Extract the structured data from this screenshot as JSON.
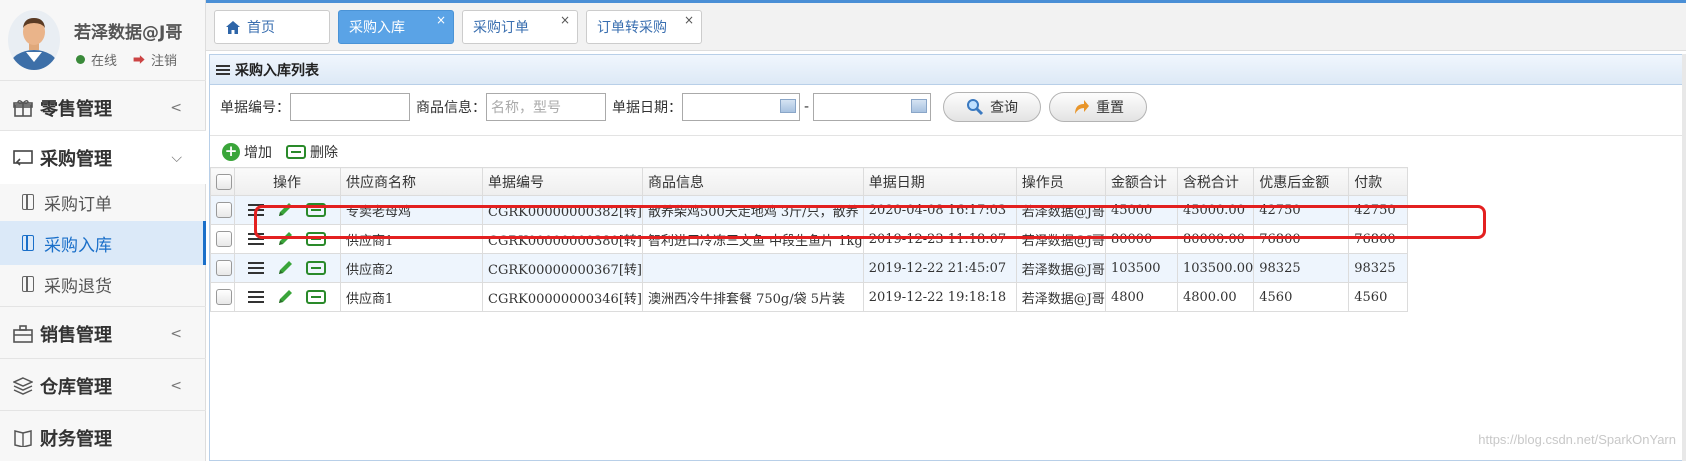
{
  "user": {
    "name": "若泽数据@J哥",
    "status": "在线",
    "logout": "注销"
  },
  "sidebar": {
    "menus": [
      {
        "label": "零售管理",
        "icon": "gift-icon",
        "open": false
      },
      {
        "label": "采购管理",
        "icon": "purchase-icon",
        "open": true
      },
      {
        "label": "销售管理",
        "icon": "briefcase-icon",
        "open": false
      },
      {
        "label": "仓库管理",
        "icon": "layers-icon",
        "open": false
      },
      {
        "label": "财务管理",
        "icon": "book-icon",
        "open": false
      }
    ],
    "sub_items": [
      {
        "label": "采购订单",
        "active": false
      },
      {
        "label": "采购入库",
        "active": true
      },
      {
        "label": "采购退货",
        "active": false
      }
    ]
  },
  "tabs": [
    {
      "label": "首页",
      "closable": false,
      "active": false
    },
    {
      "label": "采购入库",
      "closable": true,
      "active": true
    },
    {
      "label": "采购订单",
      "closable": true,
      "active": false
    },
    {
      "label": "订单转采购",
      "closable": true,
      "active": false
    }
  ],
  "panel": {
    "title": "采购入库列表"
  },
  "search": {
    "bill_no_label": "单据编号：",
    "bill_no_value": "",
    "goods_label": "商品信息：",
    "goods_placeholder": "名称，型号",
    "date_label": "单据日期：",
    "date_sep": "-",
    "date_from": "",
    "date_to": "",
    "query_label": "查询",
    "reset_label": "重置"
  },
  "toolbar": {
    "add_label": "增加",
    "delete_label": "删除"
  },
  "table": {
    "headers": [
      "操作",
      "供应商名称",
      "单据编号",
      "商品信息",
      "单据日期",
      "操作员",
      "金额合计",
      "含税合计",
      "优惠后金额",
      "付款"
    ],
    "rows": [
      {
        "supplier": "专卖老母鸡",
        "bill_no": "CGRK00000000382[转]",
        "goods": "散养柴鸡500天走地鸡 3斤/只，散养",
        "date": "2020-04-08 16:17:03",
        "operator": "若泽数据@J哥",
        "amount": "45000",
        "tax_amount": "45000.00",
        "discount_amount": "42750",
        "payment": "42750"
      },
      {
        "supplier": "供应商1",
        "bill_no": "CGRK00000000380[转]",
        "goods": "智利进口冷冻三文鱼 中段生鱼片 1kg",
        "date": "2019-12-23 11:18:07",
        "operator": "若泽数据@J哥",
        "amount": "80000",
        "tax_amount": "80000.00",
        "discount_amount": "76800",
        "payment": "76800"
      },
      {
        "supplier": "供应商2",
        "bill_no": "CGRK00000000367[转]",
        "goods": "",
        "date": "2019-12-22 21:45:07",
        "operator": "若泽数据@J哥",
        "amount": "103500",
        "tax_amount": "103500.00",
        "discount_amount": "98325",
        "payment": "98325"
      },
      {
        "supplier": "供应商1",
        "bill_no": "CGRK00000000346[转]",
        "goods": "澳洲西冷牛排套餐 750g/袋 5片装",
        "date": "2019-12-22 19:18:18",
        "operator": "若泽数据@J哥",
        "amount": "4800",
        "tax_amount": "4800.00",
        "discount_amount": "4560",
        "payment": "4560"
      }
    ]
  },
  "watermark": "https://blog.csdn.net/SparkOnYarn",
  "colors": {
    "accent": "#5aa3e6",
    "highlight": "#e32020",
    "active_bg": "#dbe9f8"
  }
}
